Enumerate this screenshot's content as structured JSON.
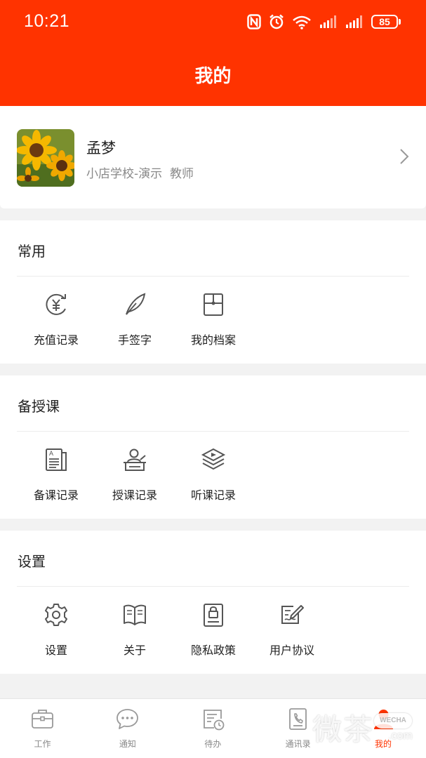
{
  "status_bar": {
    "time": "10:21",
    "battery": "85",
    "icons": [
      "nfc-icon",
      "alarm-icon",
      "wifi-icon",
      "signal-icon",
      "signal-icon",
      "battery-icon"
    ]
  },
  "header": {
    "title": "我的",
    "background": "#ff3300"
  },
  "profile": {
    "name": "孟梦",
    "school": "小店学校-演示",
    "role": "教师",
    "avatar_icon": "sunflower-avatar"
  },
  "sections": [
    {
      "title": "常用",
      "items": [
        {
          "label": "充值记录",
          "icon": "yuan-refresh-icon"
        },
        {
          "label": "手签字",
          "icon": "feather-icon"
        },
        {
          "label": "我的档案",
          "icon": "archive-icon"
        }
      ]
    },
    {
      "title": "备授课",
      "items": [
        {
          "label": "备课记录",
          "icon": "lesson-doc-icon"
        },
        {
          "label": "授课记录",
          "icon": "teacher-podium-icon"
        },
        {
          "label": "听课记录",
          "icon": "video-stack-icon"
        }
      ]
    },
    {
      "title": "设置",
      "items": [
        {
          "label": "设置",
          "icon": "gear-icon"
        },
        {
          "label": "关于",
          "icon": "book-icon"
        },
        {
          "label": "隐私政策",
          "icon": "lock-doc-icon"
        },
        {
          "label": "用户协议",
          "icon": "sign-doc-icon"
        }
      ]
    }
  ],
  "bottom_nav": {
    "items": [
      {
        "label": "工作",
        "icon": "briefcase-icon"
      },
      {
        "label": "通知",
        "icon": "chat-bubble-icon"
      },
      {
        "label": "待办",
        "icon": "todo-clock-icon"
      },
      {
        "label": "通讯录",
        "icon": "contacts-icon"
      },
      {
        "label": "我的",
        "icon": "profile-icon",
        "active": true
      }
    ],
    "active_color": "#ff3300"
  },
  "watermark": {
    "main": "微茶",
    "badge": "WECHA",
    "domain": ".com"
  }
}
